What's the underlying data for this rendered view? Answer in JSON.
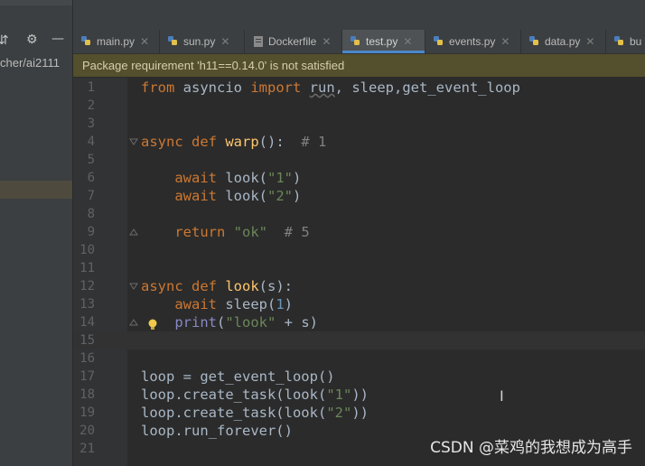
{
  "sidebar": {
    "path_fragment": "cher/ai2111",
    "tools": [
      "settings-icon",
      "collapse-icon"
    ]
  },
  "tabs": [
    {
      "label": "main.py",
      "icon": "python-file-icon",
      "active": false
    },
    {
      "label": "sun.py",
      "icon": "python-file-icon",
      "active": false
    },
    {
      "label": "Dockerfile",
      "icon": "docker-file-icon",
      "active": false
    },
    {
      "label": "test.py",
      "icon": "python-file-icon",
      "active": true
    },
    {
      "label": "events.py",
      "icon": "python-file-icon",
      "active": false
    },
    {
      "label": "data.py",
      "icon": "python-file-icon",
      "active": false
    },
    {
      "label": "bu",
      "icon": "python-file-icon",
      "active": false
    }
  ],
  "banner": {
    "message": "Package requirement 'h11==0.14.0' is not satisfied"
  },
  "editor": {
    "current_line": 15,
    "line_numbers": [
      "1",
      "2",
      "3",
      "4",
      "5",
      "6",
      "7",
      "8",
      "9",
      "10",
      "11",
      "12",
      "13",
      "14",
      "15",
      "16",
      "17",
      "18",
      "19",
      "20",
      "21"
    ]
  },
  "watermark": "CSDN @菜鸡的我想成为高手"
}
